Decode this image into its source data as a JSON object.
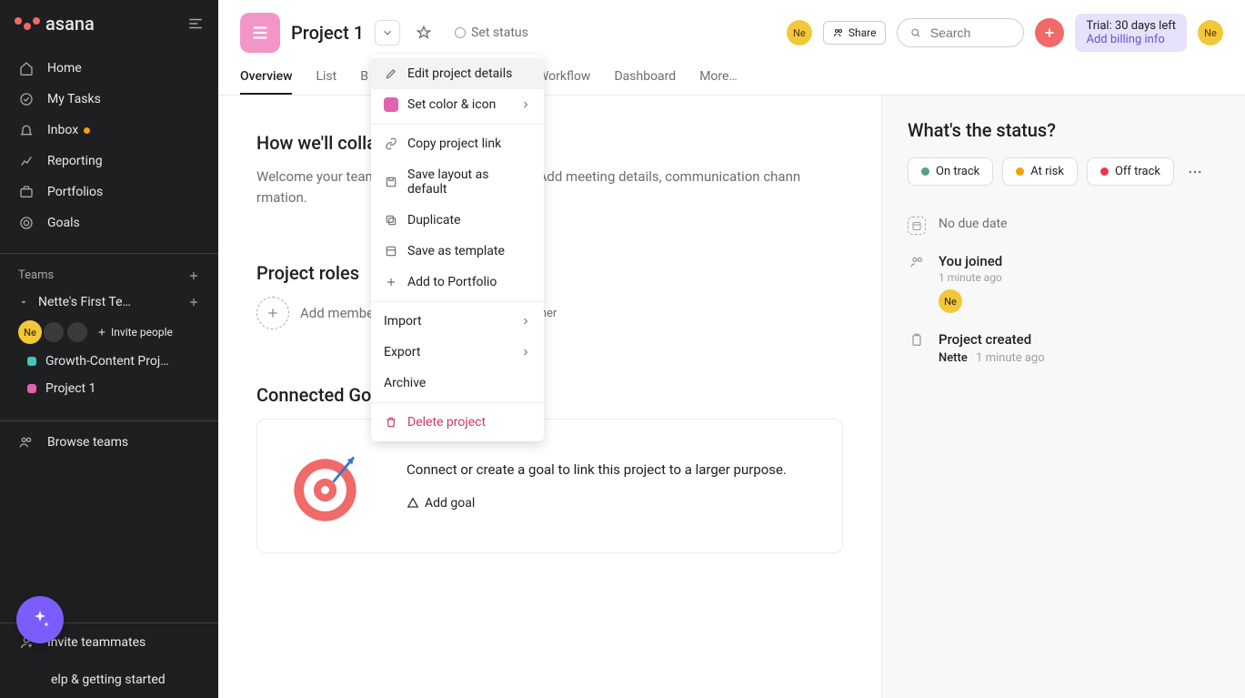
{
  "app": {
    "name": "asana"
  },
  "sidebar": {
    "nav": [
      {
        "label": "Home",
        "icon": "home"
      },
      {
        "label": "My Tasks",
        "icon": "check"
      },
      {
        "label": "Inbox",
        "icon": "bell",
        "badge": true
      },
      {
        "label": "Reporting",
        "icon": "chart"
      },
      {
        "label": "Portfolios",
        "icon": "portfolio"
      },
      {
        "label": "Goals",
        "icon": "target"
      }
    ],
    "teams_label": "Teams",
    "team_name": "Nette's First Te…",
    "invite_label": "Invite people",
    "projects": [
      {
        "label": "Growth-Content Proj…",
        "color": "#44c5bc"
      },
      {
        "label": "Project 1",
        "color": "#e362ac"
      }
    ],
    "browse_label": "Browse teams",
    "invite_teammates": "Invite teammates",
    "help_label": "elp & getting started"
  },
  "header": {
    "project_title": "Project 1",
    "set_status": "Set status",
    "share": "Share",
    "search_placeholder": "Search",
    "trial_line": "Trial: 30 days left",
    "billing_link": "Add billing info",
    "avatar_initials": "Ne"
  },
  "tabs": [
    "Overview",
    "List",
    "B",
    "Workflow",
    "Dashboard",
    "More…"
  ],
  "active_tab": "Overview",
  "dropdown": {
    "items": [
      {
        "label": "Edit project details",
        "icon": "pencil",
        "top": true
      },
      {
        "label": "Set color & icon",
        "icon": "swatch",
        "arrow": true,
        "top": true
      },
      {
        "label": "Copy project link",
        "icon": "link"
      },
      {
        "label": "Save layout as default",
        "icon": "save"
      },
      {
        "label": "Duplicate",
        "icon": "copy"
      },
      {
        "label": "Save as template",
        "icon": "template"
      },
      {
        "label": "Add to Portfolio",
        "icon": "plus"
      },
      {
        "label": "Import",
        "arrow": true,
        "noicon": true
      },
      {
        "label": "Export",
        "arrow": true,
        "noicon": true
      },
      {
        "label": "Archive",
        "noicon": true
      },
      {
        "label": "Delete project",
        "icon": "trash",
        "danger": true
      }
    ]
  },
  "overview": {
    "collab_heading": "How we'll collal",
    "collab_body": "Welcome your team a                                              work together in Asana. Add meeting details, communication chann                                  rmation.",
    "roles_heading": "Project roles",
    "add_member": "Add member",
    "owner_label": "wner",
    "goals_heading": "Connected Goals",
    "goal_body": "Connect or create a goal to link this project to a larger purpose.",
    "add_goal": "Add goal"
  },
  "aside": {
    "heading": "What's the status?",
    "statuses": [
      {
        "label": "On track",
        "color": "#58a182"
      },
      {
        "label": "At risk",
        "color": "#f2a100"
      },
      {
        "label": "Off track",
        "color": "#e8384f"
      }
    ],
    "no_due": "No due date",
    "joined_title": "You joined",
    "joined_time": "1 minute ago",
    "avatar_initials": "Ne",
    "created_title": "Project created",
    "created_by": "Nette",
    "created_time": "1 minute ago"
  }
}
